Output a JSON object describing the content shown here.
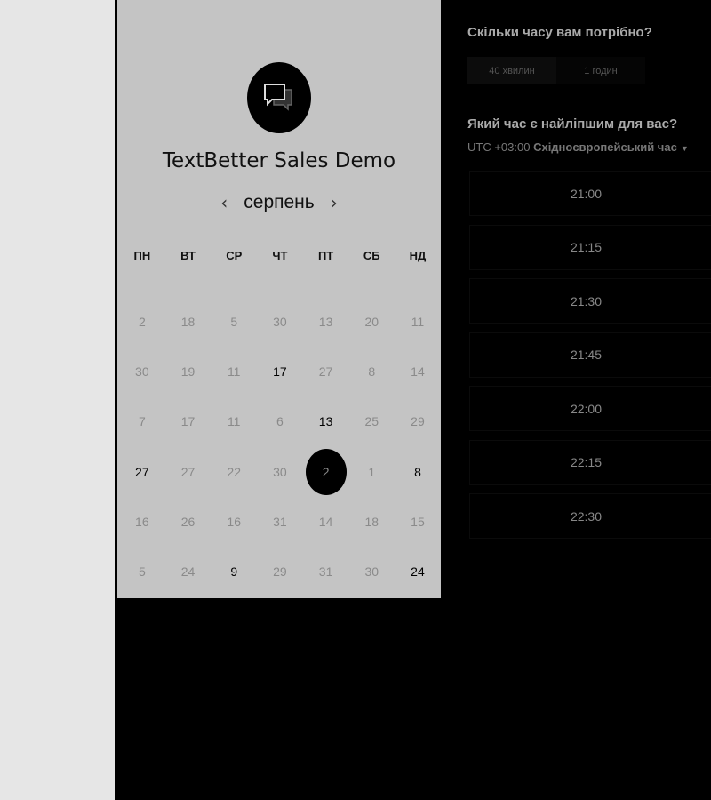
{
  "event": {
    "title": "TextBetter Sales Demo",
    "logo_icon": "chat-bubbles-icon"
  },
  "calendar": {
    "month": "серпень",
    "prev_icon": "chevron-left-icon",
    "next_icon": "chevron-right-icon",
    "weekdays": [
      "ПН",
      "ВТ",
      "СР",
      "ЧТ",
      "ПТ",
      "СБ",
      "НД"
    ],
    "weeks": [
      [
        {
          "label": "2",
          "active": false
        },
        {
          "label": "18",
          "active": false
        },
        {
          "label": "5",
          "active": false
        },
        {
          "label": "30",
          "active": false
        },
        {
          "label": "13",
          "active": false
        },
        {
          "label": "20",
          "active": false
        },
        {
          "label": "11",
          "active": false
        }
      ],
      [
        {
          "label": "30",
          "active": false
        },
        {
          "label": "19",
          "active": false
        },
        {
          "label": "11",
          "active": false
        },
        {
          "label": "17",
          "active": true
        },
        {
          "label": "27",
          "active": false
        },
        {
          "label": "8",
          "active": false
        },
        {
          "label": "14",
          "active": false
        }
      ],
      [
        {
          "label": "7",
          "active": false
        },
        {
          "label": "17",
          "active": false
        },
        {
          "label": "11",
          "active": false
        },
        {
          "label": "6",
          "active": false
        },
        {
          "label": "13",
          "active": true
        },
        {
          "label": "25",
          "active": false
        },
        {
          "label": "29",
          "active": false
        }
      ],
      [
        {
          "label": "27",
          "active": true
        },
        {
          "label": "27",
          "active": false
        },
        {
          "label": "22",
          "active": false
        },
        {
          "label": "30",
          "active": false
        },
        {
          "label": "2",
          "active": true,
          "selected": true
        },
        {
          "label": "1",
          "active": false
        },
        {
          "label": "8",
          "active": true
        }
      ],
      [
        {
          "label": "16",
          "active": false
        },
        {
          "label": "26",
          "active": false
        },
        {
          "label": "16",
          "active": false
        },
        {
          "label": "31",
          "active": false
        },
        {
          "label": "14",
          "active": false
        },
        {
          "label": "18",
          "active": false
        },
        {
          "label": "15",
          "active": false
        }
      ],
      [
        {
          "label": "5",
          "active": false
        },
        {
          "label": "24",
          "active": false
        },
        {
          "label": "9",
          "active": true
        },
        {
          "label": "29",
          "active": false
        },
        {
          "label": "31",
          "active": false
        },
        {
          "label": "30",
          "active": false
        },
        {
          "label": "24",
          "active": true
        }
      ]
    ]
  },
  "booking": {
    "duration_heading": "Скільки часу вам потрібно?",
    "durations": [
      "40 хвилин",
      "1 годин"
    ],
    "time_heading": "Який час є найліпшим для вас?",
    "timezone_offset": "UTC +03:00",
    "timezone_name": "Східноєвропейський час",
    "slots": [
      "21:00",
      "21:15",
      "21:30",
      "21:45",
      "22:00",
      "22:15",
      "22:30"
    ]
  },
  "colors": {
    "panel": "#c4c4c4",
    "page": "#000000",
    "left_strip": "#e6e6e6"
  }
}
